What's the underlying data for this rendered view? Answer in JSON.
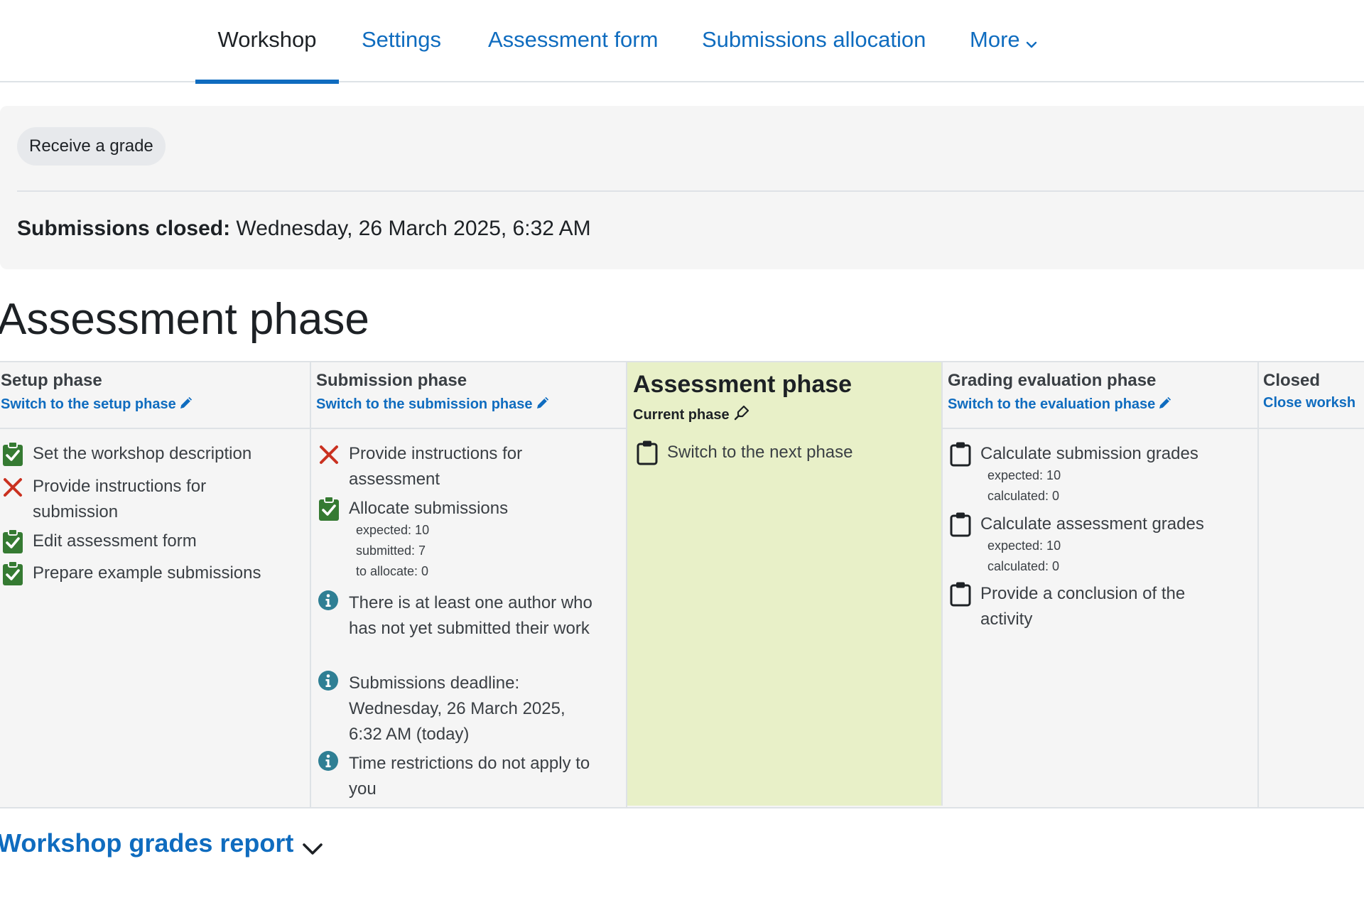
{
  "nav": {
    "tabs": [
      {
        "label": "Workshop",
        "active": true
      },
      {
        "label": "Settings",
        "active": false
      },
      {
        "label": "Assessment form",
        "active": false
      },
      {
        "label": "Submissions allocation",
        "active": false
      },
      {
        "label": "More",
        "active": false
      }
    ]
  },
  "panel": {
    "grade_pill": "Receive a grade",
    "closed_label": "Submissions closed:",
    "closed_value": "Wednesday, 26 March 2025, 6:32 AM"
  },
  "heading": "Assessment phase",
  "phases": {
    "setup": {
      "title": "Setup phase",
      "switch": "Switch to the setup phase",
      "tasks": [
        {
          "icon": "check-clipboard-icon",
          "text": "Set the workshop description"
        },
        {
          "icon": "cross-icon",
          "text": "Provide instructions for submission"
        },
        {
          "icon": "check-clipboard-icon",
          "text": "Edit assessment form"
        },
        {
          "icon": "check-clipboard-icon",
          "text": "Prepare example submissions"
        }
      ]
    },
    "submission": {
      "title": "Submission phase",
      "switch": "Switch to the submission phase",
      "tasks": [
        {
          "icon": "cross-icon",
          "text": "Provide instructions for assessment"
        },
        {
          "icon": "check-clipboard-icon",
          "text": "Allocate submissions",
          "details": [
            "expected: 10",
            "submitted: 7",
            "to allocate: 0"
          ]
        },
        {
          "icon": "info-icon",
          "text": "There is at least one author who has not yet submitted their work"
        },
        {
          "icon": "info-icon",
          "text": "Submissions deadline: Wednesday, 26 March 2025, 6:32 AM (today)"
        },
        {
          "icon": "info-icon",
          "text": "Time restrictions do not apply to you"
        }
      ]
    },
    "assessment": {
      "title": "Assessment phase",
      "current_label": "Current phase",
      "tasks": [
        {
          "icon": "clipboard-icon",
          "text": "Switch to the next phase"
        }
      ]
    },
    "evaluation": {
      "title": "Grading evaluation phase",
      "switch": "Switch to the evaluation phase",
      "tasks": [
        {
          "icon": "clipboard-icon",
          "text": "Calculate submission grades",
          "details": [
            "expected: 10",
            "calculated: 0"
          ]
        },
        {
          "icon": "clipboard-icon",
          "text": "Calculate assessment grades",
          "details": [
            "expected: 10",
            "calculated: 0"
          ]
        },
        {
          "icon": "clipboard-icon",
          "text": "Provide a conclusion of the activity"
        }
      ]
    },
    "closed": {
      "title": "Closed",
      "switch": "Close worksh"
    }
  },
  "report": {
    "label": "Workshop grades report"
  },
  "colors": {
    "link": "#0f6cbf",
    "current_phase_bg": "#e8f0c8",
    "check": "#357a32",
    "cross": "#ca3120",
    "info": "#2f7f94"
  }
}
